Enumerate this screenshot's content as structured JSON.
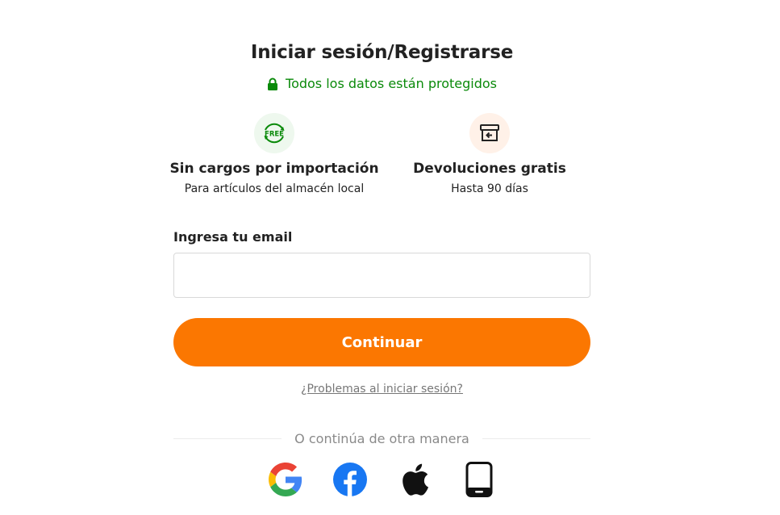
{
  "header": {
    "title": "Iniciar sesión/Registrarse",
    "secure_text": "Todos los datos están protegidos"
  },
  "benefits": [
    {
      "icon": "free-icon",
      "icon_text": "FREE",
      "title": "Sin cargos por importación",
      "subtitle": "Para artículos del almacén local"
    },
    {
      "icon": "return-box-icon",
      "title": "Devoluciones gratis",
      "subtitle": "Hasta 90 días"
    }
  ],
  "form": {
    "email_label": "Ingresa tu email",
    "email_value": "",
    "email_placeholder": "",
    "continue_label": "Continuar",
    "trouble_link": "¿Problemas al iniciar sesión?"
  },
  "alt_login": {
    "divider_text": "O continúa de otra manera",
    "providers": [
      "google-icon",
      "facebook-icon",
      "apple-icon",
      "phone-icon"
    ]
  },
  "colors": {
    "accent": "#fb7701",
    "secure_green": "#0a8a0a",
    "facebook_blue": "#1877f2"
  }
}
